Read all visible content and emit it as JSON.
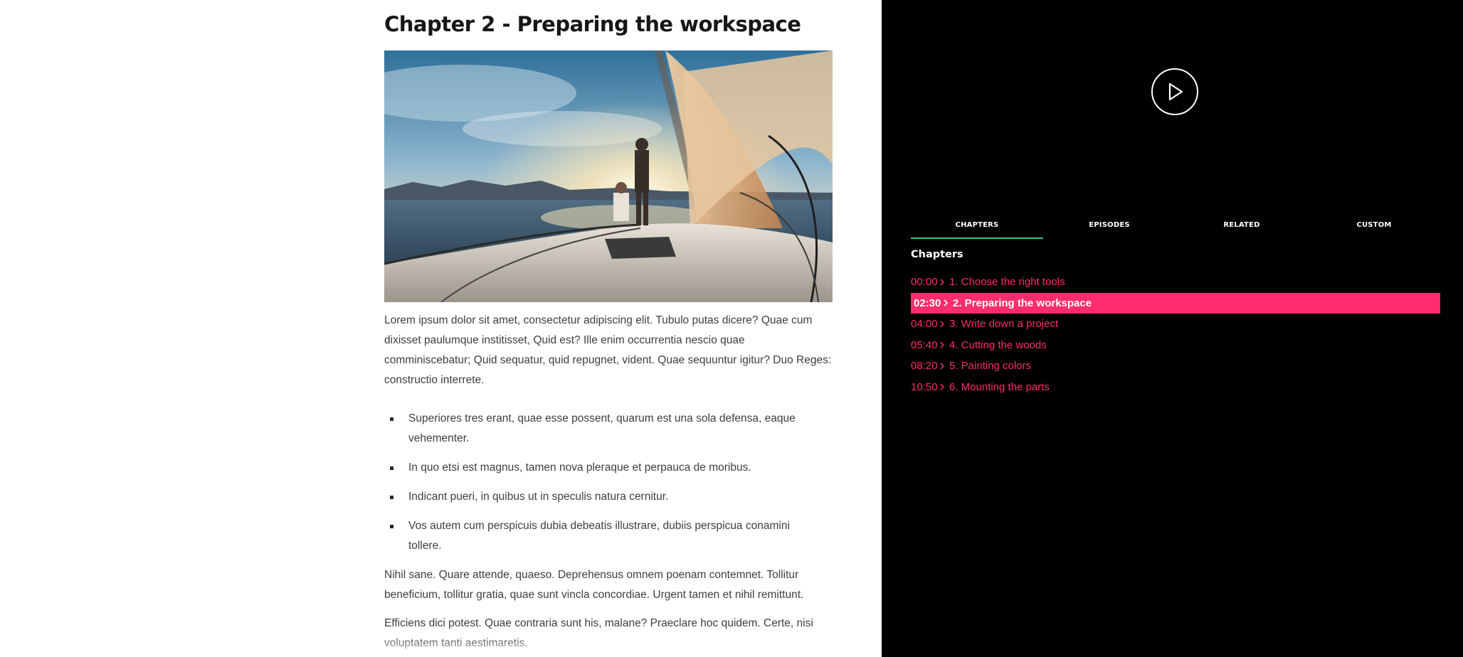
{
  "article": {
    "title": "Chapter 2 - Preparing the workspace",
    "paragraph1": "Lorem ipsum dolor sit amet, consectetur adipiscing elit. Tubulo putas dicere? Quae cum dixisset paulumque institisset, Quid est? Ille enim occurrentia nescio quae comminiscebatur; Quid sequatur, quid repugnet, vident. Quae sequuntur igitur? Duo Reges: constructio interrete.",
    "bullets": [
      "Superiores tres erant, quae esse possent, quarum est una sola defensa, eaque vehementer.",
      "In quo etsi est magnus, tamen nova pleraque et perpauca de moribus.",
      "Indicant pueri, in quibus ut in speculis natura cernitur.",
      "Vos autem cum perspicuis dubia debeatis illustrare, dubiis perspicua conamini tollere."
    ],
    "paragraph2": "Nihil sane. Quare attende, quaeso. Deprehensus omnem poenam contemnet. Tollitur beneficium, tollitur gratia, quae sunt vincla concordiae. Urgent tamen et nihil remittunt.",
    "paragraph3": "Efficiens dici potest. Quae contraria sunt his, malane? Praeclare hoc quidem. Certe, nisi voluptatem tanti aestimaretis."
  },
  "player": {
    "play_icon": "play-icon",
    "tabs": [
      {
        "label": "CHAPTERS",
        "active": true
      },
      {
        "label": "EPISODES",
        "active": false
      },
      {
        "label": "RELATED",
        "active": false
      },
      {
        "label": "CUSTOM",
        "active": false
      }
    ],
    "chapters_heading": "Chapters",
    "chapters": [
      {
        "time": "00:00",
        "label": "1. Choose the right tools",
        "active": false
      },
      {
        "time": "02:30",
        "label": "2. Preparing the workspace",
        "active": true
      },
      {
        "time": "04:00",
        "label": "3. Write down a project",
        "active": false
      },
      {
        "time": "05:40",
        "label": "4. Cutting the woods",
        "active": false
      },
      {
        "time": "08:20",
        "label": "5. Painting colors",
        "active": false
      },
      {
        "time": "10:50",
        "label": "6. Mounting the parts",
        "active": false
      }
    ]
  },
  "colors": {
    "accent": "#ff2d6d",
    "tab_underline": "#2fbf8f",
    "player_bg": "#000000"
  }
}
